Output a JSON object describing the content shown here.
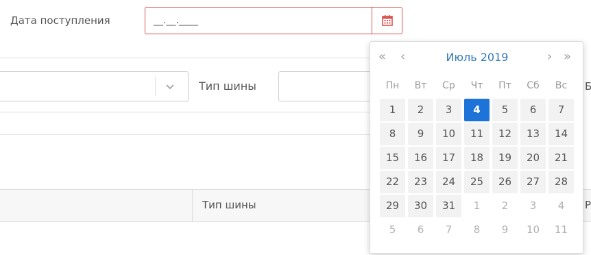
{
  "form": {
    "date_label": "Дата поступления",
    "date_value": "__.__.____",
    "tire_type_label": "Тип шины",
    "cutoff_right_1": "Б",
    "cutoff_right_2": "Р"
  },
  "table": {
    "column_tire_type": "Тип шины"
  },
  "datepicker": {
    "prev_year": "«",
    "prev_month": "‹",
    "title": "Июль 2019",
    "next_month": "›",
    "next_year": "»",
    "weekdays": [
      "Пн",
      "Вт",
      "Ср",
      "Чт",
      "Пт",
      "Сб",
      "Вс"
    ],
    "weeks": [
      [
        "1",
        "2",
        "3",
        "4",
        "5",
        "6",
        "7"
      ],
      [
        "8",
        "9",
        "10",
        "11",
        "12",
        "13",
        "14"
      ],
      [
        "15",
        "16",
        "17",
        "18",
        "19",
        "20",
        "21"
      ],
      [
        "22",
        "23",
        "24",
        "25",
        "26",
        "27",
        "28"
      ],
      [
        "29",
        "30",
        "31",
        "1",
        "2",
        "3",
        "4"
      ],
      [
        "5",
        "6",
        "7",
        "8",
        "9",
        "10",
        "11"
      ]
    ],
    "selected_day": "4",
    "accent_color": "#1e73d8"
  },
  "icons": {
    "calendar": "calendar-icon",
    "chevron": "chevron-down-icon"
  }
}
